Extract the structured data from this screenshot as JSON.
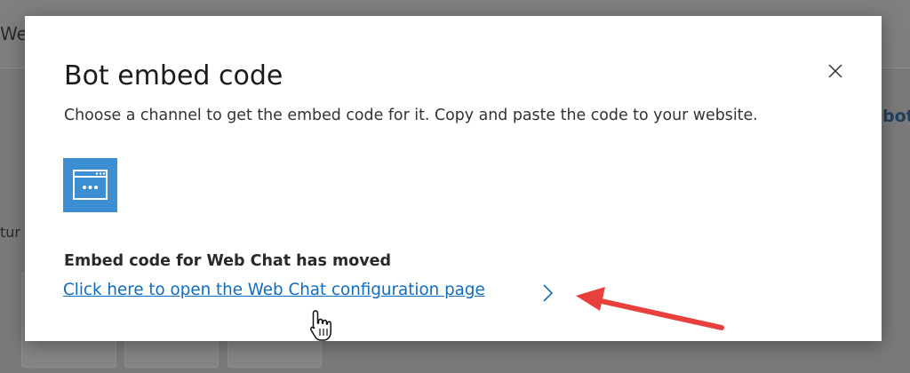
{
  "background": {
    "title_fragment": "We",
    "right_fragment": "bot",
    "left_fragment": "tur"
  },
  "modal": {
    "title": "Bot embed code",
    "subtitle": "Choose a channel to get the embed code for it. Copy and paste the code to your website.",
    "close_icon": "close-icon",
    "channel_icon": "web-window-icon",
    "moved_heading": "Embed code for Web Chat has moved",
    "config_link": "Click here to open the Web Chat configuration page",
    "link_chevron_icon": "chevron-right-icon"
  },
  "colors": {
    "overlay": "#7a7a7a",
    "tile": "#3d8fd4",
    "link": "#0f6cbd",
    "annotation_arrow": "#e8413d"
  }
}
